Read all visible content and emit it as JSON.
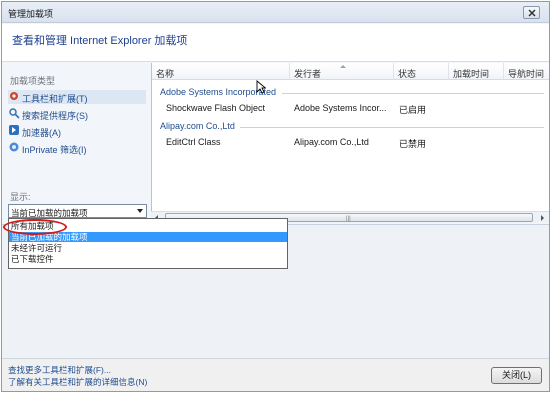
{
  "window": {
    "title": "管理加载项"
  },
  "header": {
    "heading": "查看和管理 Internet Explorer 加载项"
  },
  "sidebar": {
    "types_label": "加载项类型",
    "items": [
      {
        "label": "工具栏和扩展(T)",
        "icon": "gear-icon"
      },
      {
        "label": "搜索提供程序(S)",
        "icon": "search-icon"
      },
      {
        "label": "加速器(A)",
        "icon": "accelerator-icon"
      },
      {
        "label": "InPrivate 筛选(I)",
        "icon": "inprivate-icon"
      }
    ],
    "show_label": "显示:",
    "show_select": {
      "value": "当前已加载的加载项",
      "options": [
        "所有加载项",
        "当前已加载的加载项",
        "未经许可运行",
        "已下载控件"
      ],
      "highlighted_index": 1
    }
  },
  "table": {
    "columns": [
      "名称",
      "发行者",
      "状态",
      "加载时间",
      "导航时间"
    ],
    "groups": [
      {
        "name": "Adobe Systems Incorporated",
        "rows": [
          {
            "name": "Shockwave Flash Object",
            "publisher": "Adobe Systems Incor...",
            "status": "已启用"
          }
        ]
      },
      {
        "name": "Alipay.com Co.,Ltd",
        "rows": [
          {
            "name": "EditCtrl Class",
            "publisher": "Alipay.com Co.,Ltd",
            "status": "已禁用"
          }
        ]
      }
    ]
  },
  "footer": {
    "links": [
      "查找更多工具栏和扩展(F)...",
      "了解有关工具栏和扩展的详细信息(N)"
    ],
    "close_button": "关闭(L)"
  },
  "colors": {
    "link": "#1f4c8f",
    "selection": "#3399ff",
    "highlight_ring": "#d11c1c"
  }
}
